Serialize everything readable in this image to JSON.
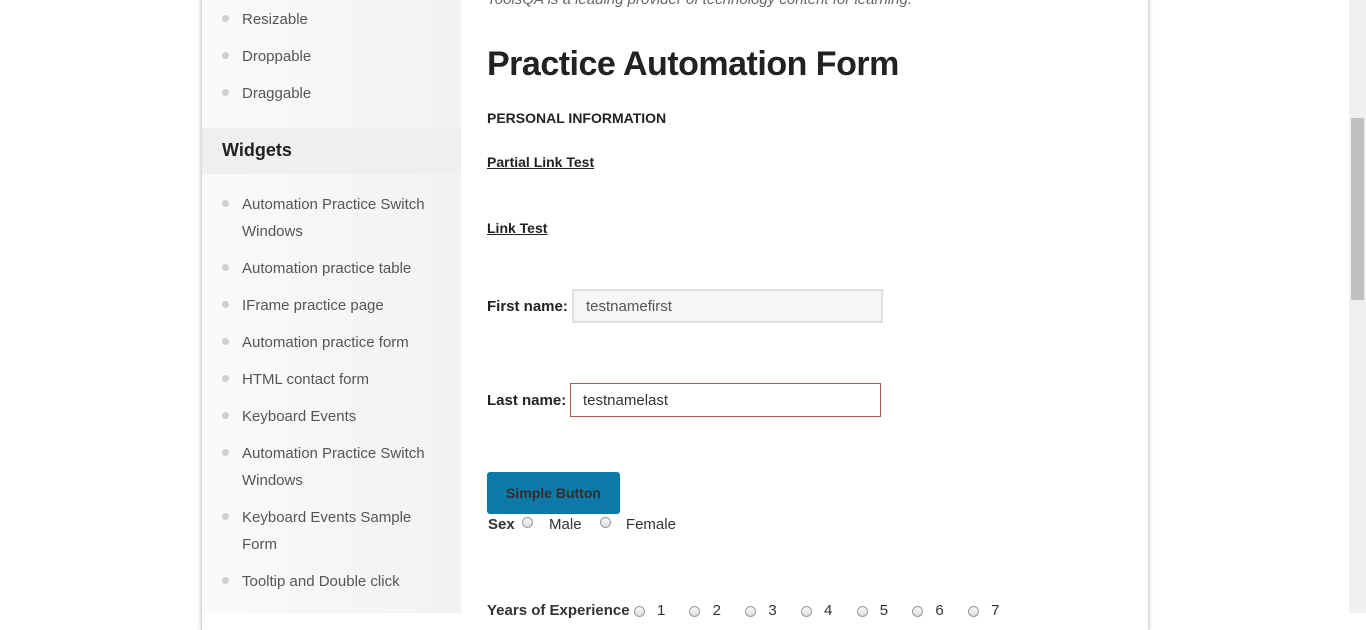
{
  "sidebar": {
    "top_items": [
      {
        "label": "Resizable"
      },
      {
        "label": "Droppable"
      },
      {
        "label": "Draggable"
      }
    ],
    "widgets_title": "Widgets",
    "widget_items": [
      {
        "label": "Automation Practice Switch Windows"
      },
      {
        "label": "Automation practice table"
      },
      {
        "label": "IFrame practice page"
      },
      {
        "label": "Automation practice form"
      },
      {
        "label": "HTML contact form"
      },
      {
        "label": "Keyboard Events"
      },
      {
        "label": "Automation Practice Switch Windows"
      },
      {
        "label": "Keyboard Events Sample Form"
      },
      {
        "label": "Tooltip and Double click"
      }
    ]
  },
  "main": {
    "intro": "ToolsQA is a leading provider of technology content for learning.",
    "title": "Practice Automation Form",
    "section_label": "PERSONAL INFORMATION",
    "partial_link": "Partial Link Test",
    "link": "Link Test",
    "first_name_label": "First name:",
    "first_name_value": "testnamefirst",
    "last_name_label": "Last name:",
    "last_name_value": "testnamelast",
    "button_label": "Simple Button",
    "sex_label": "Sex",
    "sex_options": [
      "Male",
      "Female"
    ],
    "experience_label": "Years of Experience",
    "experience_options": [
      "1",
      "2",
      "3",
      "4",
      "5",
      "6",
      "7"
    ]
  }
}
